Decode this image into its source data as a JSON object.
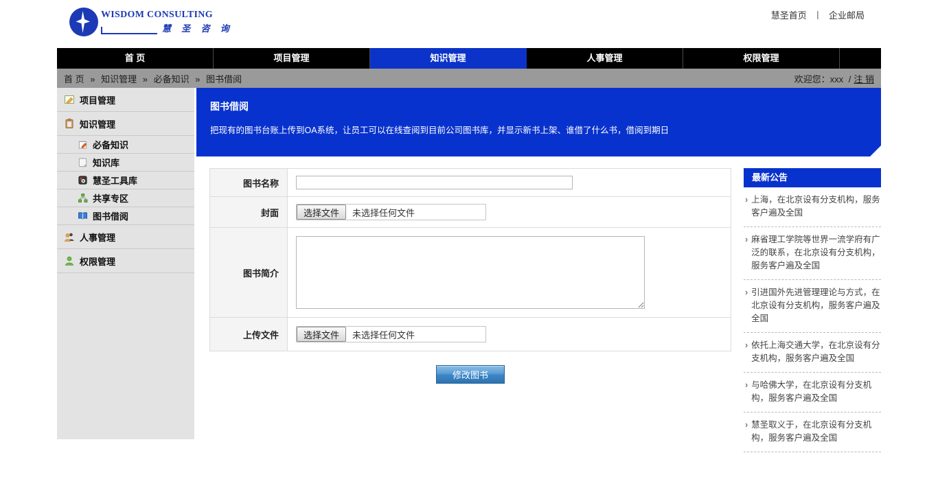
{
  "brand": {
    "name": "WISDOM CONSULTING",
    "name_cn": "慧 圣 咨 询",
    "logo_blue": "#1c3ab5"
  },
  "top_links": {
    "home": "慧圣首页",
    "separator": "丨",
    "mail": "企业邮局"
  },
  "nav": {
    "active_color": "#0b33c9",
    "tabs": [
      {
        "label": "首 页",
        "active": false
      },
      {
        "label": "项目管理",
        "active": false
      },
      {
        "label": "知识管理",
        "active": true
      },
      {
        "label": "人事管理",
        "active": false
      },
      {
        "label": "权限管理",
        "active": false
      }
    ]
  },
  "breadcrumb": {
    "items": [
      "首 页",
      "知识管理",
      "必备知识",
      "图书借阅"
    ],
    "separator": "»",
    "welcome_prefix": "欢迎您：",
    "user": "xxx",
    "slash": "/",
    "logout": "注 销"
  },
  "sidebar": {
    "items": [
      {
        "label": "项目管理",
        "icon": "note-pencil-icon",
        "level": 1
      },
      {
        "label": "知识管理",
        "icon": "clipboard-icon",
        "level": 1
      },
      {
        "label": "必备知识",
        "icon": "notepad-edit-icon",
        "level": 2
      },
      {
        "label": "知识库",
        "icon": "book-icon",
        "level": 2
      },
      {
        "label": "慧圣工具库",
        "icon": "toolbox-gear-icon",
        "level": 2
      },
      {
        "label": "共享专区",
        "icon": "sitemap-icon",
        "level": 2
      },
      {
        "label": "图书借阅",
        "icon": "open-book-icon",
        "level": 2
      },
      {
        "label": "人事管理",
        "icon": "people-icon",
        "level": 1
      },
      {
        "label": "权限管理",
        "icon": "person-icon",
        "level": 1
      }
    ]
  },
  "banner": {
    "title": "图书借阅",
    "description": "把现有的图书台账上传到OA系统，让员工可以在线查阅到目前公司图书库，并显示新书上架、谁借了什么书，借阅到期日",
    "color": "#0832cd"
  },
  "form": {
    "fields": [
      {
        "label": "图书名称",
        "type": "text",
        "value": ""
      },
      {
        "label": "封面",
        "type": "file",
        "button": "选择文件",
        "status": "未选择任何文件"
      },
      {
        "label": "图书简介",
        "type": "textarea",
        "value": ""
      },
      {
        "label": "上传文件",
        "type": "file",
        "button": "选择文件",
        "status": "未选择任何文件"
      }
    ],
    "submit_label": "修改图书"
  },
  "notices": {
    "title": "最新公告",
    "bullet": "›",
    "items": [
      "上海，在北京设有分支机构，服务客户遍及全国",
      "麻省理工学院等世界一流学府有广泛的联系，在北京设有分支机构，服务客户遍及全国",
      "引进国外先进管理理论与方式，在北京设有分支机构，服务客户遍及全国",
      "依托上海交通大学，在北京设有分支机构，服务客户遍及全国",
      "与哈佛大学，在北京设有分支机构，服务客户遍及全国",
      "慧圣取义于，在北京设有分支机构，服务客户遍及全国"
    ]
  }
}
